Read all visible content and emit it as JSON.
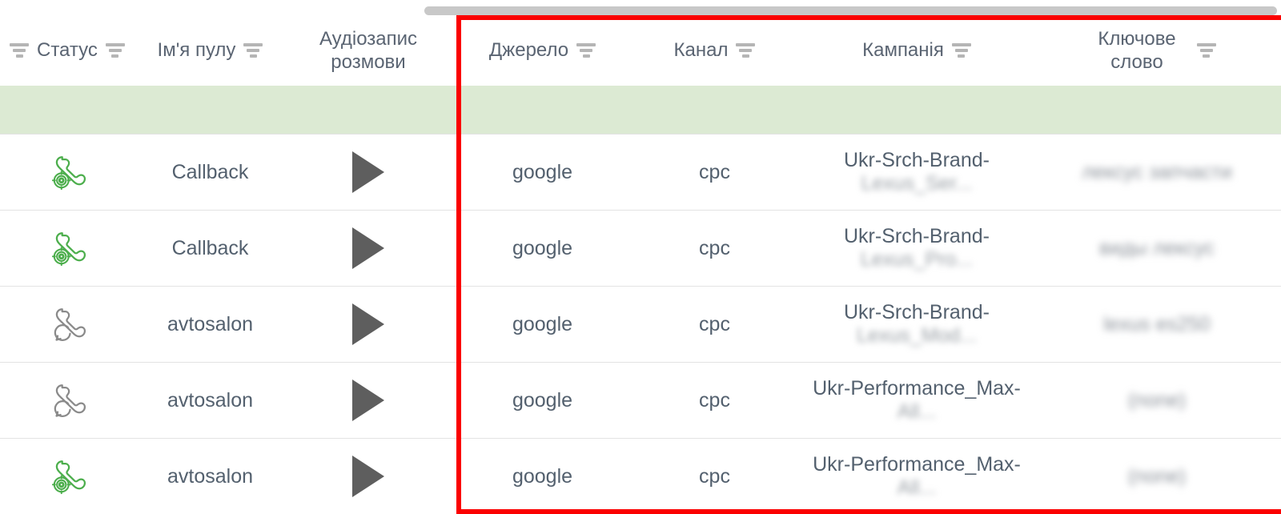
{
  "scrollbar": {
    "orientation": "horizontal",
    "thumb_color": "#c8c8c8"
  },
  "annotation": {
    "shape": "rectangle",
    "color": "#fb0000",
    "covers_columns": [
      "Джерело",
      "Канал",
      "Кампанія",
      "Ключове слово"
    ]
  },
  "table": {
    "columns": [
      {
        "key": "status",
        "label": "Статус",
        "filterable": true,
        "leading_filter": true
      },
      {
        "key": "pool",
        "label": "Ім'я пулу",
        "filterable": true,
        "leading_filter": false
      },
      {
        "key": "audio",
        "label": "Аудіозапис\nрозмови",
        "filterable": false,
        "leading_filter": false
      },
      {
        "key": "source",
        "label": "Джерело",
        "filterable": true,
        "leading_filter": false
      },
      {
        "key": "channel",
        "label": "Канал",
        "filterable": true,
        "leading_filter": false
      },
      {
        "key": "campaign",
        "label": "Кампанія",
        "filterable": true,
        "leading_filter": false
      },
      {
        "key": "keyword",
        "label": "Ключове\nслово",
        "filterable": true,
        "leading_filter": false
      }
    ],
    "summary_row": {
      "highlight_color": "#dcead3",
      "cells": [
        "",
        "",
        "",
        "",
        "",
        "",
        ""
      ]
    },
    "rows": [
      {
        "status_icon": "phone-callback-answered-icon",
        "status_color": "#4cae4c",
        "pool": "Callback",
        "audio_icon": "play-icon",
        "source": "google",
        "channel": "cpc",
        "campaign_line1": "Ukr-Srch-Brand-",
        "campaign_line2": "Lexus_Ser...",
        "keyword": "лексус запчасти"
      },
      {
        "status_icon": "phone-callback-answered-icon",
        "status_color": "#4cae4c",
        "pool": "Callback",
        "audio_icon": "play-icon",
        "source": "google",
        "channel": "cpc",
        "campaign_line1": "Ukr-Srch-Brand-",
        "campaign_line2": "Lexus_Pro...",
        "keyword": "виды лексус"
      },
      {
        "status_icon": "phone-missed-icon",
        "status_color": "#8a8a8a",
        "pool": "avtosalon",
        "audio_icon": "play-icon",
        "source": "google",
        "channel": "cpc",
        "campaign_line1": "Ukr-Srch-Brand-",
        "campaign_line2": "Lexus_Mod...",
        "keyword": "lexus es250"
      },
      {
        "status_icon": "phone-missed-icon",
        "status_color": "#8a8a8a",
        "pool": "avtosalon",
        "audio_icon": "play-icon",
        "source": "google",
        "channel": "cpc",
        "campaign_line1": "Ukr-Performance_Max-",
        "campaign_line2": "All...",
        "keyword": "(none)"
      },
      {
        "status_icon": "phone-callback-answered-icon",
        "status_color": "#4cae4c",
        "pool": "avtosalon",
        "audio_icon": "play-icon",
        "source": "google",
        "channel": "cpc",
        "campaign_line1": "Ukr-Performance_Max-",
        "campaign_line2": "All...",
        "keyword": "(none)"
      }
    ]
  }
}
